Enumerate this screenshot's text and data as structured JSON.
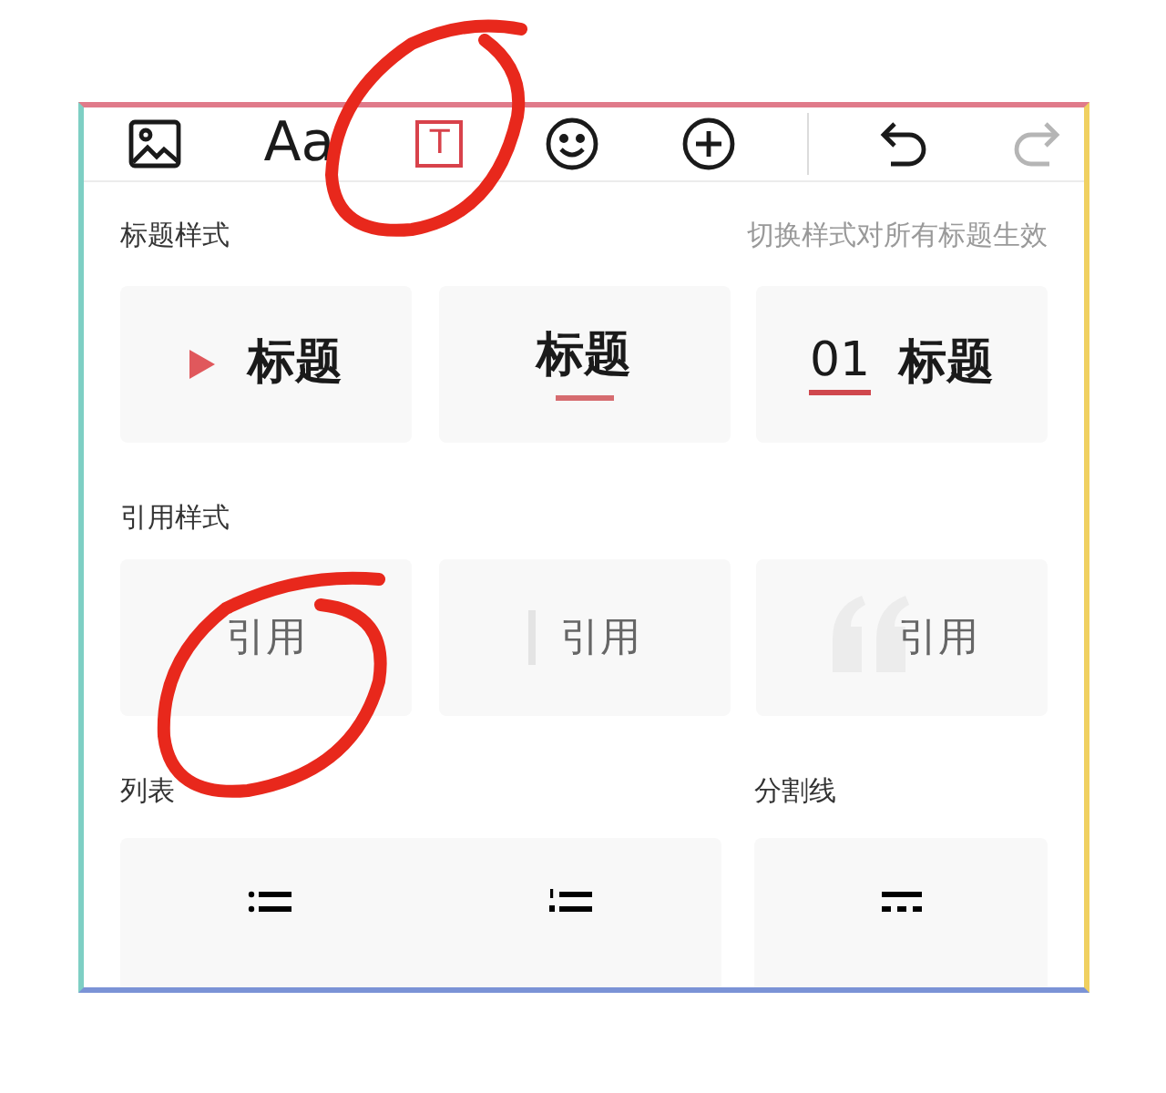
{
  "toolbar": [
    {
      "kind": "image",
      "selected": false,
      "disabled": false
    },
    {
      "kind": "font",
      "label": "Aa",
      "selected": false,
      "disabled": false
    },
    {
      "kind": "textbox",
      "label": "T",
      "selected": true,
      "disabled": false
    },
    {
      "kind": "emoji",
      "selected": false,
      "disabled": false
    },
    {
      "kind": "add",
      "selected": false,
      "disabled": false
    },
    {
      "kind": "separator"
    },
    {
      "kind": "undo",
      "selected": false,
      "disabled": false
    },
    {
      "kind": "redo",
      "selected": false,
      "disabled": true
    }
  ],
  "heading_styles": {
    "title": "标题样式",
    "hint": "切换样式对所有标题生效",
    "options": [
      {
        "kind": "triangle",
        "label": "标题"
      },
      {
        "kind": "underline",
        "label": "标题"
      },
      {
        "kind": "number",
        "number": "01",
        "label": "标题"
      }
    ]
  },
  "quote_styles": {
    "title": "引用样式",
    "options": [
      {
        "kind": "plain",
        "label": "引用"
      },
      {
        "kind": "bar",
        "label": "引用"
      },
      {
        "kind": "quote-mark",
        "label": "引用"
      }
    ]
  },
  "list": {
    "title": "列表",
    "options": [
      {
        "kind": "bulleted"
      },
      {
        "kind": "numbered"
      }
    ]
  },
  "divider": {
    "title": "分割线",
    "options": [
      {
        "kind": "dashed"
      }
    ]
  },
  "annotations": [
    {
      "kind": "circle"
    },
    {
      "kind": "circle"
    }
  ]
}
